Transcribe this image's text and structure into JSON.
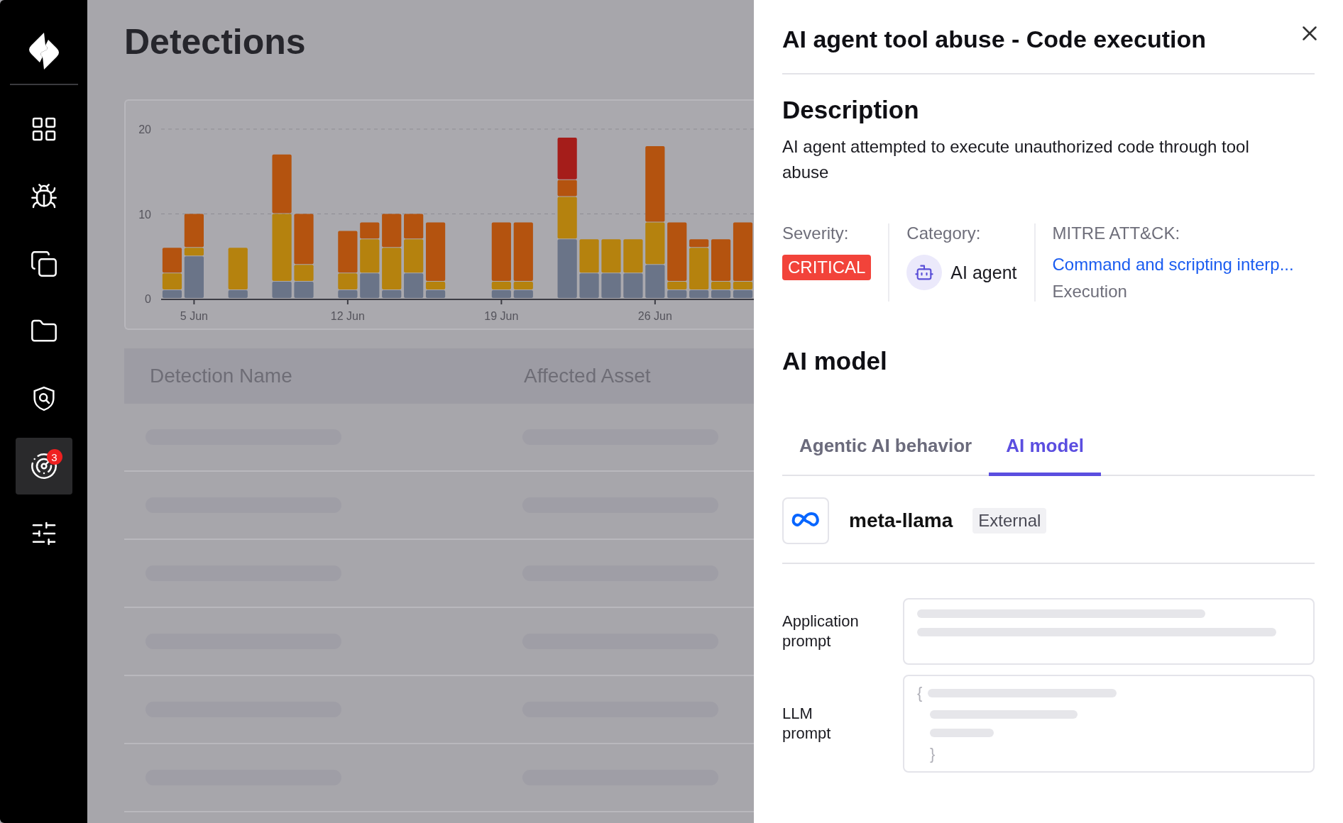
{
  "sidebar": {
    "items": [
      {
        "kind": "dashboard",
        "selected": false
      },
      {
        "kind": "bug",
        "selected": false
      },
      {
        "kind": "copy",
        "selected": false
      },
      {
        "kind": "folder",
        "selected": false
      },
      {
        "kind": "shield",
        "selected": false
      },
      {
        "kind": "radar",
        "selected": true,
        "badge": "3"
      },
      {
        "kind": "sliders",
        "selected": false
      }
    ]
  },
  "page": {
    "title": "Detections",
    "chart": {
      "chart_data": {
        "type": "bar",
        "stacked": true,
        "categories": [
          null,
          "5 Jun",
          null,
          null,
          null,
          null,
          null,
          null,
          "12 Jun",
          null,
          null,
          null,
          null,
          null,
          null,
          "19 Jun",
          null,
          null,
          null,
          null,
          null,
          null,
          "26 Jun",
          null,
          null,
          null,
          null
        ],
        "series": [
          {
            "color": "#6a7488",
            "values": [
              1,
              5,
              null,
              1,
              null,
              2,
              2,
              null,
              1,
              3,
              1,
              3,
              1,
              null,
              null,
              1,
              1,
              null,
              7,
              3,
              3,
              3,
              4,
              1,
              1,
              1,
              1
            ]
          },
          {
            "color": "#b5820e",
            "values": [
              2,
              1,
              null,
              5,
              null,
              8,
              2,
              null,
              2,
              4,
              5,
              4,
              1,
              null,
              null,
              1,
              1,
              null,
              5,
              4,
              4,
              4,
              5,
              1,
              5,
              1,
              1
            ]
          },
          {
            "color": "#b4530f",
            "values": [
              3,
              4,
              null,
              null,
              null,
              7,
              6,
              null,
              5,
              2,
              4,
              3,
              7,
              null,
              null,
              7,
              7,
              null,
              2,
              null,
              null,
              null,
              9,
              7,
              1,
              5,
              7
            ]
          },
          {
            "color": "#a51d1a",
            "values": [
              null,
              null,
              null,
              null,
              null,
              null,
              null,
              null,
              null,
              null,
              null,
              null,
              null,
              null,
              null,
              null,
              null,
              null,
              5,
              null,
              null,
              null,
              null,
              null,
              null,
              null,
              null
            ]
          }
        ],
        "ylim": [
          0,
          20
        ],
        "yticks": [
          0,
          10,
          20
        ]
      }
    }
  },
  "table": {
    "columns": [
      "Detection Name",
      "Affected Asset"
    ],
    "loading": true
  },
  "drawer": {
    "title": "AI agent tool abuse - Code execution",
    "description": {
      "heading": "Description",
      "text": "AI agent attempted to execute unauthorized code through tool abuse"
    },
    "severity": {
      "label": "Severity:",
      "value": "CRITICAL"
    },
    "category": {
      "label": "Category:",
      "value": "AI agent"
    },
    "mitre": {
      "label": "MITRE ATT&CK:",
      "technique": "Command and scripting interp...",
      "tactic": "Execution"
    },
    "section_title": "AI model",
    "tabs": [
      {
        "label": "Agentic AI behavior",
        "selected": false
      },
      {
        "label": "AI model",
        "selected": true
      }
    ],
    "model": {
      "name": "meta-llama",
      "tag": "External"
    },
    "prompts": [
      {
        "label": "Application prompt",
        "kind": "text"
      },
      {
        "label": "LLM prompt",
        "kind": "json",
        "open": "{",
        "close": "}"
      }
    ]
  }
}
